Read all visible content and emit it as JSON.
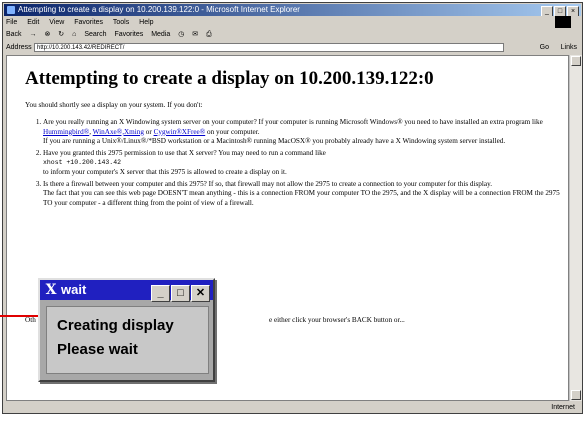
{
  "browser": {
    "window_title": "Attempting to create a display on 10.200.139.122:0 - Microsoft Internet Explorer",
    "menu": [
      "File",
      "Edit",
      "View",
      "Favorites",
      "Tools",
      "Help"
    ],
    "toolbar": [
      "Back",
      "Search",
      "Favorites",
      "Media"
    ],
    "address_label": "Address",
    "address_url": "http://10.200.143.42/REDIRECT/",
    "go_label": "Go",
    "links_label": "Links",
    "status_zone": "Internet"
  },
  "page": {
    "heading": "Attempting to create a display on 10.200.139.122:0",
    "intro": "You should shortly see a display on your system. If you don't:",
    "items": [
      {
        "a": "Are you really running an X Windowing system server on your computer? If your computer is running Microsoft Windows® you need to have installed an extra program like ",
        "link1": "Hummingbird®",
        "sep1": ", ",
        "link2": "WinAxe®,Xming",
        "sep2": " or ",
        "link3": "Cygwin®XFree®",
        "b": " on your computer.",
        "c": "If you are running a Unix®/Linux®/*BSD workstation or a Macintosh® running MacOSX® you probably already have a X Windowing system server installed."
      },
      {
        "a": "Have you granted this 2975 permission to use that X server? You may need to run a command like",
        "cmd": "xhost +10.200.143.42",
        "b": "to inform your computer's X server that this 2975 is allowed to create a display on it."
      },
      {
        "a": "Is there a firewall between your computer and this 2975? If so, that firewall may not allow the 2975 to create a connection to your computer for this display.",
        "b": "The fact that you can see this web page DOESN'T mean anything - this is a connection FROM your computer TO the 2975, and the X display will be a connection FROM the 2975 TO your computer - a different thing from the point of view of a firewall."
      }
    ],
    "other_left": "Oth",
    "other_right": "e either click your browser's BACK button or..."
  },
  "wait_dialog": {
    "title": "wait",
    "x_logo": "X",
    "line1": "Creating display",
    "line2": "Please wait",
    "btn_min": "_",
    "btn_max": "□",
    "btn_close": "✕"
  },
  "colors": {
    "title_blue": "#0a246a",
    "wait_title": "#2020c0",
    "pointer": "#e00000"
  }
}
